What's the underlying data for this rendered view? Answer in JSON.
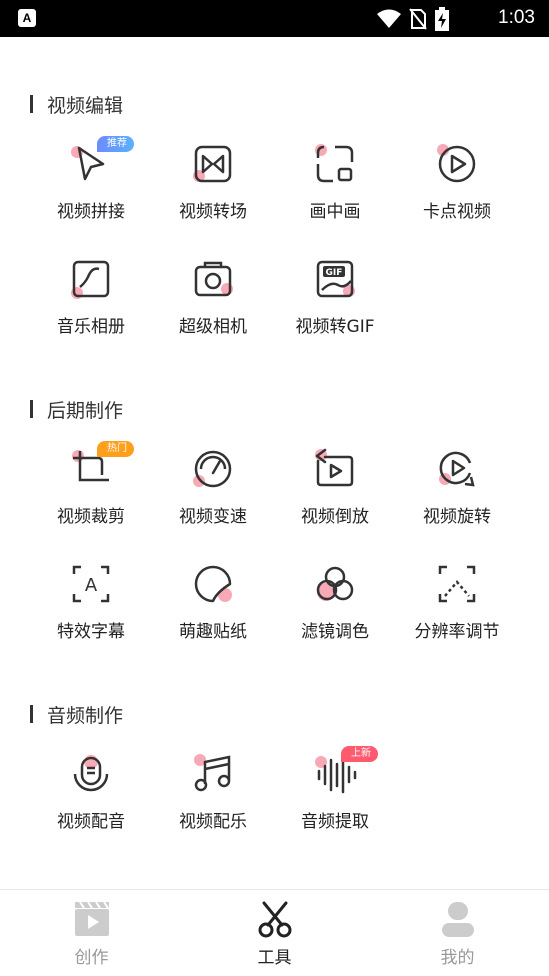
{
  "status_bar": {
    "app_glyph": "A",
    "time": "1:03",
    "icons": [
      "wifi-icon",
      "no-sim-icon",
      "battery-charging-icon"
    ]
  },
  "sections": [
    {
      "title": "视频编辑",
      "tools": [
        {
          "label": "视频拼接",
          "icon": "cursor-play-icon",
          "badge": "推荐"
        },
        {
          "label": "视频转场",
          "icon": "transition-icon"
        },
        {
          "label": "画中画",
          "icon": "picture-in-picture-icon"
        },
        {
          "label": "卡点视频",
          "icon": "play-circle-icon"
        },
        {
          "label": "音乐相册",
          "icon": "music-album-icon"
        },
        {
          "label": "超级相机",
          "icon": "camera-icon"
        },
        {
          "label": "视频转GIF",
          "icon": "gif-icon"
        }
      ]
    },
    {
      "title": "后期制作",
      "tools": [
        {
          "label": "视频裁剪",
          "icon": "crop-icon",
          "badge": "热门"
        },
        {
          "label": "视频变速",
          "icon": "speed-gauge-icon"
        },
        {
          "label": "视频倒放",
          "icon": "reverse-play-icon"
        },
        {
          "label": "视频旋转",
          "icon": "rotate-icon"
        },
        {
          "label": "特效字幕",
          "icon": "subtitle-icon"
        },
        {
          "label": "萌趣贴纸",
          "icon": "sticker-icon"
        },
        {
          "label": "滤镜调色",
          "icon": "filter-icon"
        },
        {
          "label": "分辨率调节",
          "icon": "resolution-icon"
        }
      ]
    },
    {
      "title": "音频制作",
      "tools": [
        {
          "label": "视频配音",
          "icon": "microphone-icon"
        },
        {
          "label": "视频配乐",
          "icon": "music-note-icon"
        },
        {
          "label": "音频提取",
          "icon": "audio-wave-icon",
          "badge": "上新"
        }
      ]
    }
  ],
  "tabbar": {
    "tabs": [
      {
        "label": "创作",
        "icon": "clapper-icon",
        "active": false
      },
      {
        "label": "工具",
        "icon": "scissors-icon",
        "active": true
      },
      {
        "label": "我的",
        "icon": "user-icon",
        "active": false
      }
    ]
  },
  "colors": {
    "accent_pink": "#f7a9b6",
    "text": "#222222",
    "inactive": "#999999"
  }
}
